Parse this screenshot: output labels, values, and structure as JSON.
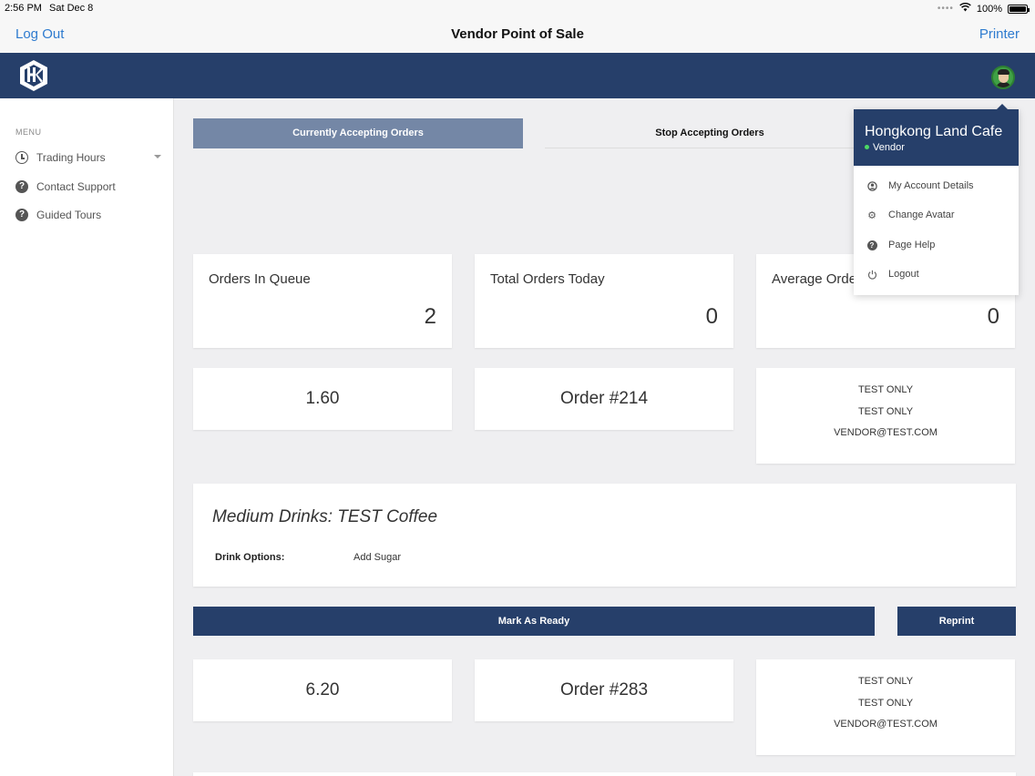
{
  "status_bar": {
    "time": "2:56 PM",
    "date": "Sat Dec 8",
    "battery": "100%"
  },
  "nav": {
    "left": "Log Out",
    "title": "Vendor Point of Sale",
    "right": "Printer"
  },
  "sidebar": {
    "menu_title": "MENU",
    "items": [
      {
        "label": "Trading Hours",
        "icon": "clock-icon"
      },
      {
        "label": "Contact Support",
        "icon": "question-icon"
      },
      {
        "label": "Guided Tours",
        "icon": "question-icon"
      }
    ]
  },
  "controls": {
    "accepting": "Currently Accepting Orders",
    "stop": "Stop Accepting Orders"
  },
  "stats": [
    {
      "label": "Orders In Queue",
      "value": "2"
    },
    {
      "label": "Total Orders Today",
      "value": "0"
    },
    {
      "label": "Average Orde",
      "value": "0"
    }
  ],
  "orders": [
    {
      "amount": "1.60",
      "number": "Order #214",
      "info": [
        "TEST ONLY",
        "TEST ONLY",
        "VENDOR@TEST.COM"
      ],
      "item_title": "Medium Drinks: TEST Coffee",
      "option_label": "Drink Options:",
      "option_value": "Add Sugar",
      "ready_label": "Mark As Ready",
      "reprint_label": "Reprint"
    },
    {
      "amount": "6.20",
      "number": "Order #283",
      "info": [
        "TEST ONLY",
        "TEST ONLY",
        "VENDOR@TEST.COM"
      ]
    }
  ],
  "dropdown": {
    "name": "Hongkong Land Cafe",
    "role": "Vendor",
    "items": [
      {
        "label": "My Account Details",
        "icon": "account-icon"
      },
      {
        "label": "Change Avatar",
        "icon": "gear-icon"
      },
      {
        "label": "Page Help",
        "icon": "question-icon"
      },
      {
        "label": "Logout",
        "icon": "power-icon"
      }
    ]
  },
  "colors": {
    "header": "#263f6a",
    "accent_link": "#2e7bcf",
    "accepting_button": "#7487a6",
    "online_dot": "#4cd964"
  }
}
